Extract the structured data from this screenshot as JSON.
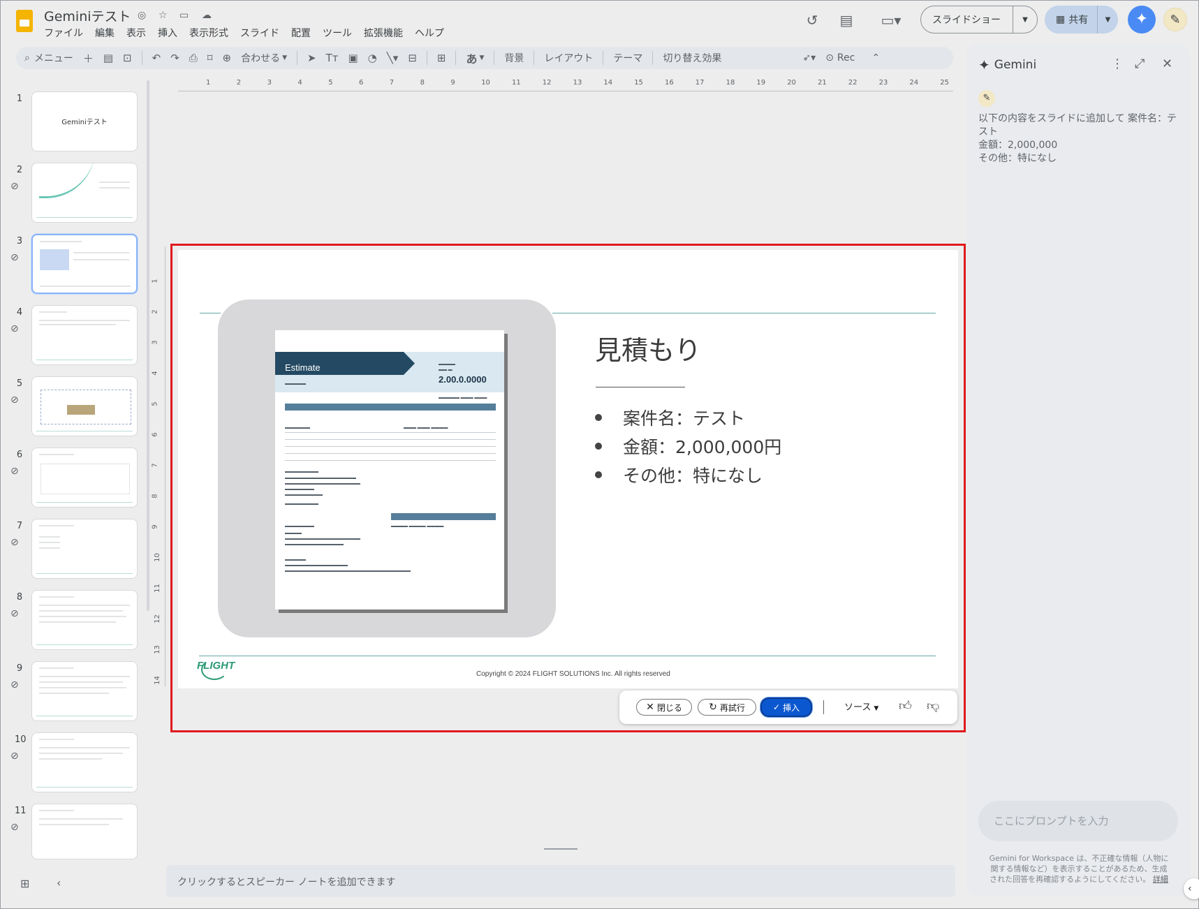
{
  "app": {
    "title": "Geminiテスト",
    "menu": [
      "ファイル",
      "編集",
      "表示",
      "挿入",
      "表示形式",
      "スライド",
      "配置",
      "ツール",
      "拡張機能",
      "ヘルプ"
    ],
    "slideshow_label": "スライドショー",
    "share_label": "共有"
  },
  "toolbar": {
    "search_label": "メニュー",
    "zoom_label": "合わせる",
    "input_tool_label": "あ",
    "background_label": "背景",
    "layout_label": "レイアウト",
    "theme_label": "テーマ",
    "transition_label": "切り替え効果",
    "rec_label": "Rec"
  },
  "thumbnails": [
    {
      "num": "1",
      "title": "Geminiテスト"
    },
    {
      "num": "2"
    },
    {
      "num": "3"
    },
    {
      "num": "4"
    },
    {
      "num": "5"
    },
    {
      "num": "6"
    },
    {
      "num": "7"
    },
    {
      "num": "8"
    },
    {
      "num": "9"
    },
    {
      "num": "10"
    },
    {
      "num": "11"
    }
  ],
  "ruler": {
    "h": [
      "1",
      "2",
      "3",
      "4",
      "5",
      "6",
      "7",
      "8",
      "9",
      "10",
      "11",
      "12",
      "13",
      "14",
      "15",
      "16",
      "17",
      "18",
      "19",
      "20",
      "21",
      "22",
      "23",
      "24",
      "25"
    ],
    "v": [
      "1",
      "2",
      "3",
      "4",
      "5",
      "6",
      "7",
      "8",
      "9",
      "10",
      "11",
      "12",
      "13",
      "14"
    ]
  },
  "slide": {
    "title": "見積もり",
    "bullets": [
      "案件名：テスト",
      "金額：2,000,000円",
      "その他：特になし"
    ],
    "logo_text": "FLIGHT",
    "copyright": "Copyright ©  2024 FLIGHT SOLUTIONS Inc. All rights reserved",
    "doc": {
      "banner": "Estimate",
      "amount": "2.00.0.0000"
    }
  },
  "actions": {
    "close_label": "閉じる",
    "retry_label": "再試行",
    "insert_label": "挿入",
    "source_label": "ソース"
  },
  "notes": {
    "placeholder": "クリックするとスピーカー ノートを追加できます"
  },
  "gemini": {
    "title": "Gemini",
    "prompt_lines": [
      "以下の内容をスライドに追加して 案件名：テスト",
      "金額：2,000,000",
      "その他：特になし"
    ],
    "input_placeholder": "ここにプロンプトを入力",
    "disclaimer": "Gemini for Workspace は、不正確な情報（人物に関する情報など）を表示することがあるため、生成された回答を再確認するようにしてください。",
    "disclaimer_link": "詳細"
  },
  "colors": {
    "accent": "#0b57d0",
    "frame": "#e0191f",
    "teal": "#5fa9a2"
  }
}
